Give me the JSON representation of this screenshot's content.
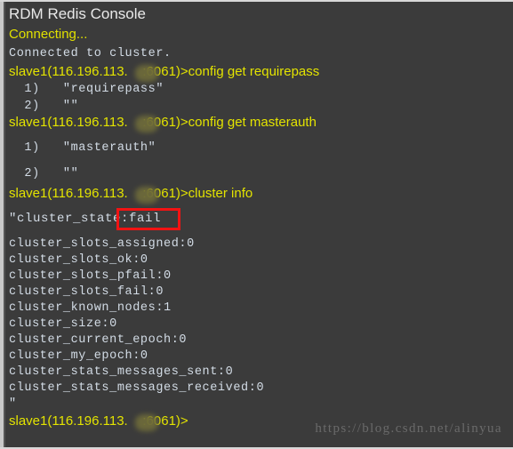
{
  "window": {
    "title": "RDM Redis Console",
    "background_color": "#3b3b3b",
    "prompt_color": "#e3e300",
    "output_color": "#d3dce6",
    "highlight_color": "#f21313"
  },
  "status": {
    "connecting": "Connecting...",
    "connected": "Connected to cluster."
  },
  "prompts": {
    "p1": "slave1(116.196.113.    :6061)>config get requirepass",
    "p2": "slave1(116.196.113.    :6061)>config get masterauth",
    "p3": "slave1(116.196.113.    :6061)>cluster info",
    "p4": "slave1(116.196.113.    :6061)>"
  },
  "requirepass_result": [
    "  1)   \"requirepass\"",
    "  2)   \"\""
  ],
  "masterauth_result": [
    "  1)   \"masterauth\"",
    "  2)   \"\""
  ],
  "cluster_info": {
    "first_line": "\"cluster_state:fail",
    "state_field": "cluster_state",
    "state_value": "fail",
    "highlight_text": ":fail",
    "lines": [
      "cluster_slots_assigned:0",
      "cluster_slots_ok:0",
      "cluster_slots_pfail:0",
      "cluster_slots_fail:0",
      "cluster_known_nodes:1",
      "cluster_size:0",
      "cluster_current_epoch:0",
      "cluster_my_epoch:0",
      "cluster_stats_messages_sent:0",
      "cluster_stats_messages_received:0"
    ],
    "closing_quote": "\""
  },
  "watermark": {
    "text": "https://blog.csdn.net/alinyua"
  }
}
